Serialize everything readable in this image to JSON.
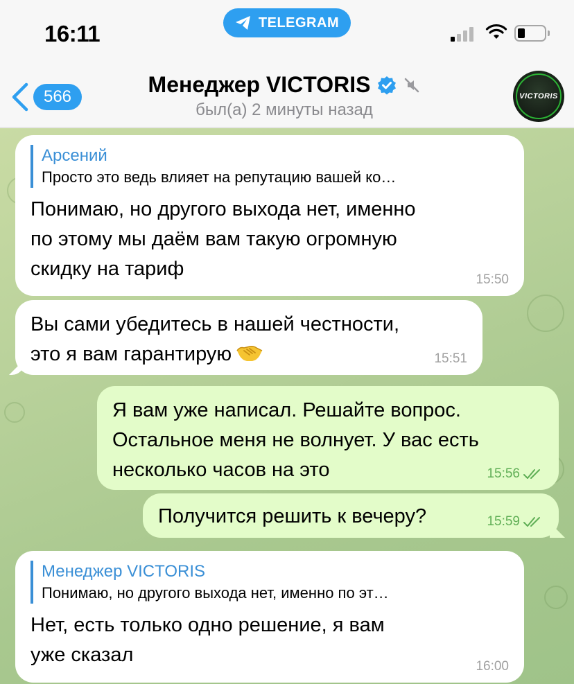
{
  "status_bar": {
    "time": "16:11",
    "app_pill": "TELEGRAM"
  },
  "header": {
    "unread_count": "566",
    "contact_name": "Менеджер VICTORIS",
    "last_seen": "был(а) 2 минуты назад",
    "avatar_text": "VICTORIS"
  },
  "messages": [
    {
      "direction": "in",
      "reply_name": "Арсений",
      "reply_text": "Просто это ведь влияет на репутацию вашей ко…",
      "lines": [
        "Понимаю, но другого выхода нет, именно",
        "по этому мы даём вам такую огромную",
        "скидку на тариф"
      ],
      "time": "15:50"
    },
    {
      "direction": "in",
      "lines": [
        "Вы сами убедитесь в нашей честности,",
        "это я вам гарантирую"
      ],
      "emoji": "handshake-icon",
      "time": "15:51"
    },
    {
      "direction": "out",
      "lines": [
        "Я вам уже написал. Решайте вопрос.",
        "Остальное меня не волнует. У вас есть",
        "несколько часов на это"
      ],
      "time": "15:56"
    },
    {
      "direction": "out",
      "lines": [
        "Получится решить к вечеру?"
      ],
      "time": "15:59"
    },
    {
      "direction": "in",
      "reply_name": "Менеджер VICTORIS",
      "reply_text": "Понимаю, но другого выхода нет, именно по эт…",
      "lines": [
        "Нет, есть только одно решение, я вам",
        "уже сказал"
      ],
      "time": "16:00"
    }
  ],
  "colors": {
    "accent": "#2e9ff0",
    "reply_accent": "#3a8fd6",
    "outgoing_bubble": "#e3fcc9",
    "incoming_bubble": "#ffffff",
    "read_check": "#5fae55"
  }
}
